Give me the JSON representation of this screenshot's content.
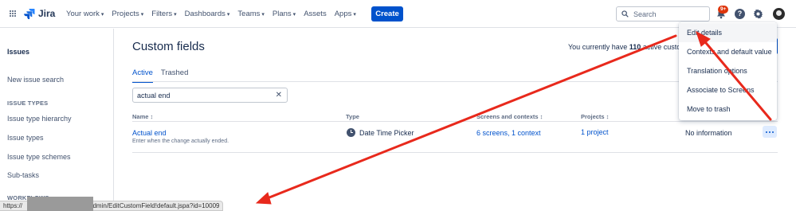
{
  "topnav": {
    "app_name": "Jira",
    "items": [
      {
        "label": "Your work",
        "caret": "▾"
      },
      {
        "label": "Projects",
        "caret": "▾"
      },
      {
        "label": "Filters",
        "caret": "▾"
      },
      {
        "label": "Dashboards",
        "caret": "▾"
      },
      {
        "label": "Teams",
        "caret": "▾"
      },
      {
        "label": "Plans",
        "caret": "▾"
      },
      {
        "label": "Assets",
        "caret": ""
      },
      {
        "label": "Apps",
        "caret": "▾"
      }
    ],
    "create_label": "Create",
    "search_placeholder": "Search",
    "notification_badge": "9+",
    "help_glyph": "?"
  },
  "sidebar": {
    "title": "Issues",
    "new_issue_search": "New issue search",
    "section_issue_types": "ISSUE TYPES",
    "items": [
      "Issue type hierarchy",
      "Issue types",
      "Issue type schemes",
      "Sub-tasks"
    ],
    "section_workflows": "WORKFLOWS"
  },
  "main": {
    "title": "Custom fields",
    "info_prefix": "You currently have ",
    "info_count": "110",
    "info_suffix": " active custom",
    "tabs": [
      {
        "label": "Active"
      },
      {
        "label": "Trashed"
      }
    ],
    "filter_value": "actual end",
    "clear_glyph": "✕",
    "columns": [
      "Name ↕",
      "Type",
      "Screens and contexts ↕",
      "Projects ↕"
    ],
    "row": {
      "name": "Actual end",
      "description": "Enter when the change actually ended.",
      "type": "Date Time Picker",
      "screens": "6 screens, 1 context",
      "projects": "1 project",
      "last_value": "No information"
    }
  },
  "menu": {
    "items": [
      "Edit details",
      "Contexts and default value",
      "Translation options",
      "Associate to Screens",
      "Move to trash"
    ]
  },
  "statusbar": {
    "url": "https://                         /secure/admin/EditCustomField!default.jspa?id=10009"
  },
  "colors": {
    "brand": "#0052cc",
    "annotation": "#e8291c",
    "badge": "#de350b"
  }
}
